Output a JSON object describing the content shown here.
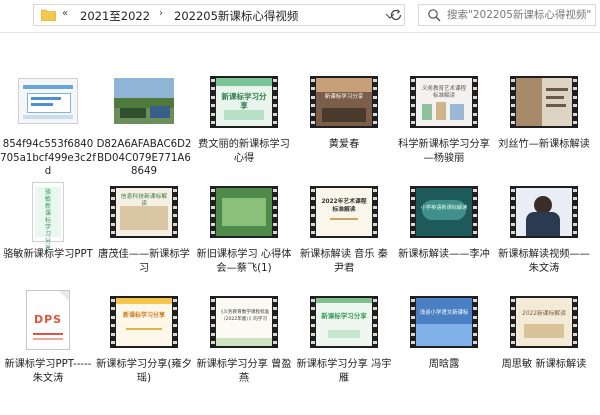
{
  "address_bar": {
    "crumbs": [
      "2021至2022",
      "202205新课标心得视频"
    ],
    "overflow": "«",
    "separator": "›"
  },
  "search": {
    "placeholder": "搜索\"202205新课标心得视频\""
  },
  "colors": {
    "accent_green": "#3a9b5c",
    "film": "#1f1f1f",
    "folder": "#f2c94c",
    "dps_red": "#e0533d"
  },
  "files": [
    {
      "name": "854f94c553f6840705a1bcf499e3c2fd",
      "thumb": "photo-icon"
    },
    {
      "name": "D82A6AFABAC6D2BD04C079E771A68649",
      "thumb": "photo-icon"
    },
    {
      "name": "费文丽的新课标学习心得",
      "thumb": "video-icon"
    },
    {
      "name": "黄爱春",
      "thumb": "video-icon"
    },
    {
      "name": "科学新课标学习分享—杨骏丽",
      "thumb": "video-icon"
    },
    {
      "name": "刘丝竹—新课标解读",
      "thumb": "video-icon"
    },
    {
      "name": "骆敏新课标学习PPT",
      "thumb": "video-icon"
    },
    {
      "name": "唐茂佳——新课标学习",
      "thumb": "video-icon"
    },
    {
      "name": "新旧课标学习 心得体会—蔡飞(1)",
      "thumb": "video-icon"
    },
    {
      "name": "新课标解读 音乐 秦尹君",
      "thumb": "video-icon"
    },
    {
      "name": "新课标解读——李冲",
      "thumb": "video-icon"
    },
    {
      "name": "新课标解读视频——朱文涛",
      "thumb": "video-icon"
    },
    {
      "name": "新课标学习PPT-----朱文涛",
      "thumb": "dps-file-icon"
    },
    {
      "name": "新课标学习分享(雍夕瑶)",
      "thumb": "video-icon"
    },
    {
      "name": "新课标学习分享 曾盈燕",
      "thumb": "video-icon"
    },
    {
      "name": "新课标学习分享 冯宇雁",
      "thumb": "video-icon"
    },
    {
      "name": "周晗露",
      "thumb": "video-icon"
    },
    {
      "name": "周思敏 新课标解读",
      "thumb": "video-icon"
    }
  ],
  "thumb_text": {
    "t3": "新课标学习分享",
    "t4": "新课标学习分享",
    "t5": "义务教育艺术课程标准解读",
    "t8": "信息科技新课标解读",
    "t10": "2022年艺术课程标准解读",
    "t11": "小学英语新课标解读",
    "t14": "新课标学习分享",
    "t15": "《义务教育数学课程标准（2022年版）》的学习",
    "t16": "新课标学习分享",
    "t17": "浅谈小学语文新课标",
    "t18": "2022新课标解读",
    "dps": "DPS",
    "t7": "骆敏新课标学习分享"
  }
}
